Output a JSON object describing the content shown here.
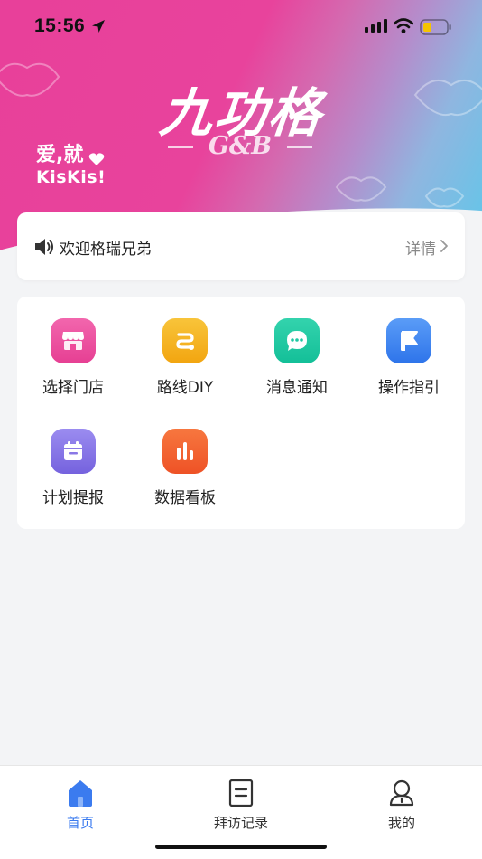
{
  "status_bar": {
    "time": "15:56"
  },
  "brand": {
    "title": "九功格",
    "subtitle": "G&B",
    "slogan_line1": "爱,就",
    "slogan_line2": "KisKis!"
  },
  "notice": {
    "message": "欢迎格瑞兄弟",
    "more_label": "详情"
  },
  "menu": {
    "items": [
      {
        "label": "选择门店",
        "icon": "store-icon",
        "color": "#ee4a9a"
      },
      {
        "label": "路线DIY",
        "icon": "route-icon",
        "color": "#f5b21c"
      },
      {
        "label": "消息通知",
        "icon": "message-icon",
        "color": "#1fc9a3"
      },
      {
        "label": "操作指引",
        "icon": "flag-icon",
        "color": "#3e86f3"
      },
      {
        "label": "计划提报",
        "icon": "calendar-icon",
        "color": "#8a78e6"
      },
      {
        "label": "数据看板",
        "icon": "bar-chart-icon",
        "color": "#f26232"
      }
    ]
  },
  "tabbar": {
    "tabs": [
      {
        "label": "首页",
        "icon": "home-icon",
        "active": true
      },
      {
        "label": "拜访记录",
        "icon": "document-icon",
        "active": false
      },
      {
        "label": "我的",
        "icon": "user-icon",
        "active": false
      }
    ],
    "active_color": "#3b7bef"
  }
}
